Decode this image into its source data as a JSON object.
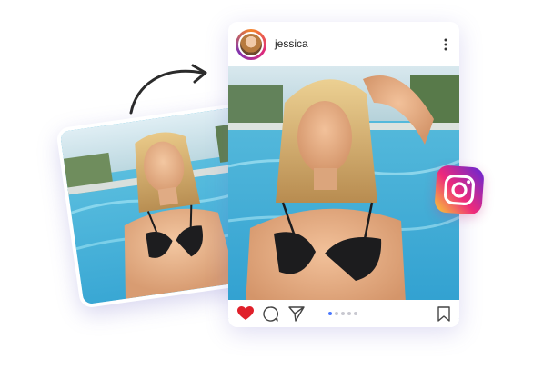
{
  "post": {
    "username": "jessica",
    "carousel_total": 5,
    "carousel_active_index": 0
  },
  "colors": {
    "like_heart": "#e0202a",
    "carousel_active_dot": "#4a78ff",
    "carousel_dot": "#c8c8d0",
    "instagram_gradient": [
      "#f9ce34",
      "#ee2a7b",
      "#6228d7"
    ]
  },
  "icons": {
    "arrow": "curved-arrow-icon",
    "more": "more-vertical-icon",
    "like": "heart-icon",
    "comment": "comment-icon",
    "share": "send-icon",
    "save": "bookmark-icon",
    "brand": "instagram-icon"
  }
}
